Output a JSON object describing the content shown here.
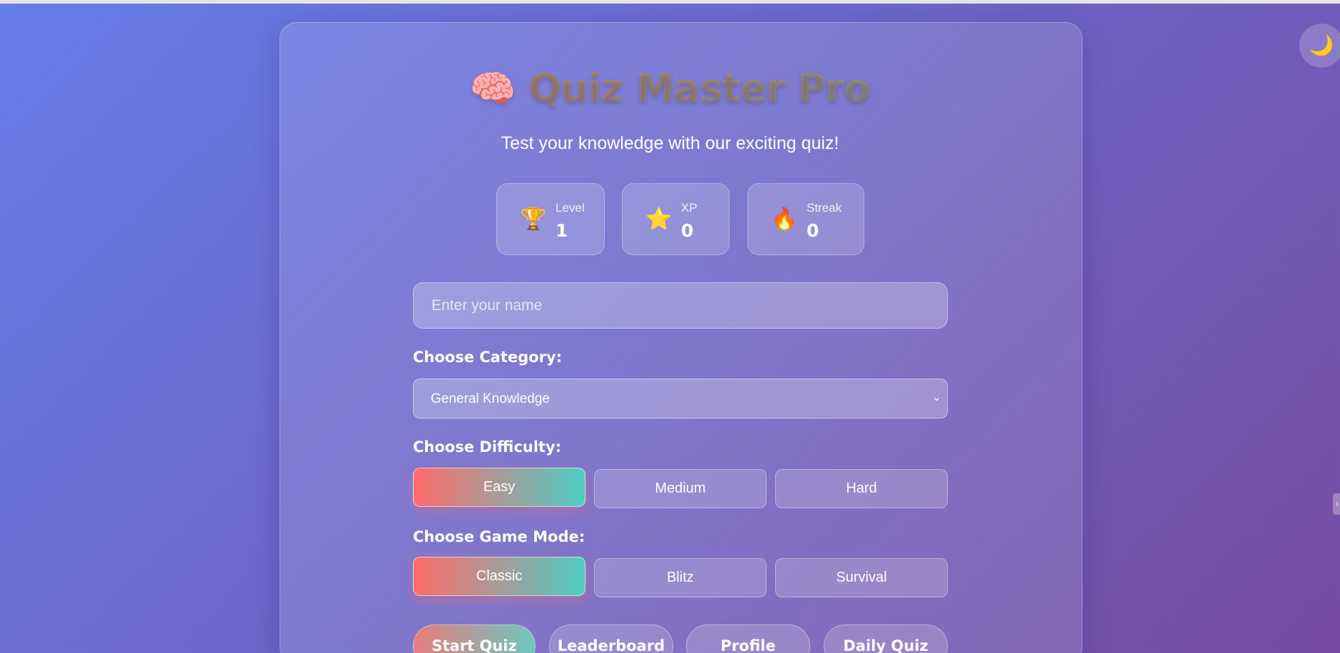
{
  "app": {
    "title_icon": "🧠",
    "title_text": "Quiz Master Pro",
    "subtitle": "Test your knowledge with our exciting quiz!"
  },
  "stats": [
    {
      "icon": "🏆",
      "icon_name": "trophy-icon",
      "label": "Level",
      "value": "1"
    },
    {
      "icon": "⭐",
      "icon_name": "star-icon",
      "label": "XP",
      "value": "0"
    },
    {
      "icon": "🔥",
      "icon_name": "fire-icon",
      "label": "Streak",
      "value": "0"
    }
  ],
  "name_input": {
    "placeholder": "Enter your name",
    "value": ""
  },
  "category": {
    "label": "Choose Category:",
    "selected": "General Knowledge"
  },
  "difficulty": {
    "label": "Choose Difficulty:",
    "options": [
      "Easy",
      "Medium",
      "Hard"
    ],
    "selected": "Easy"
  },
  "game_mode": {
    "label": "Choose Game Mode:",
    "options": [
      "Classic",
      "Blitz",
      "Survival"
    ],
    "selected": "Classic"
  },
  "actions": [
    "Start Quiz",
    "Leaderboard",
    "Profile",
    "Daily Quiz"
  ],
  "theme_toggle": {
    "icon": "🌙",
    "icon_name": "moon-icon"
  },
  "colors": {
    "bg_start": "#667eea",
    "bg_end": "#764ba2",
    "accent_start": "#ff6b6b",
    "accent_end": "#4ecdc4"
  }
}
